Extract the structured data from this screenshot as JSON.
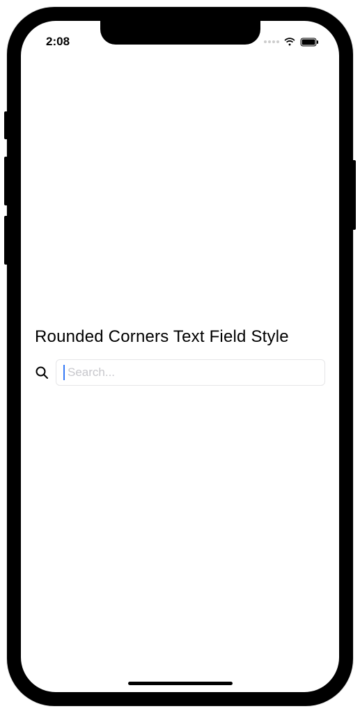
{
  "status": {
    "time": "2:08"
  },
  "content": {
    "heading": "Rounded Corners Text Field Style",
    "search": {
      "placeholder": "Search...",
      "value": ""
    }
  }
}
